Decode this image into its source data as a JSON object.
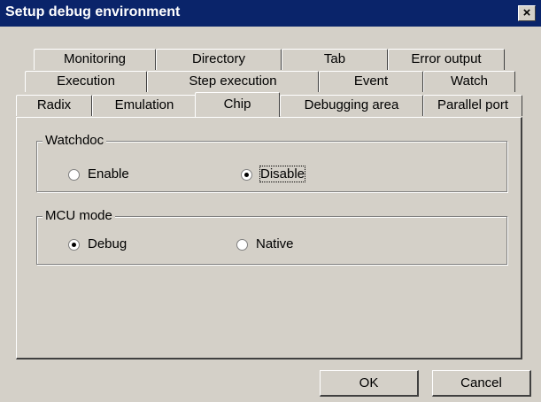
{
  "window": {
    "title": "Setup debug environment"
  },
  "close_glyph": "×",
  "tabs": {
    "row1": [
      "Monitoring",
      "Directory",
      "Tab",
      "Error output"
    ],
    "row2": [
      "Execution",
      "Step execution",
      "Event",
      "Watch"
    ],
    "row3": [
      "Radix",
      "Emulation",
      "Chip",
      "Debugging area",
      "Parallel port"
    ],
    "selected": "Chip"
  },
  "watchdog": {
    "legend": "Watchdoc",
    "enable_label": "Enable",
    "disable_label": "Disable",
    "selected": "Disable"
  },
  "mcu_mode": {
    "legend": "MCU mode",
    "debug_label": "Debug",
    "native_label": "Native",
    "selected": "Debug"
  },
  "buttons": {
    "ok": "OK",
    "cancel": "Cancel"
  }
}
